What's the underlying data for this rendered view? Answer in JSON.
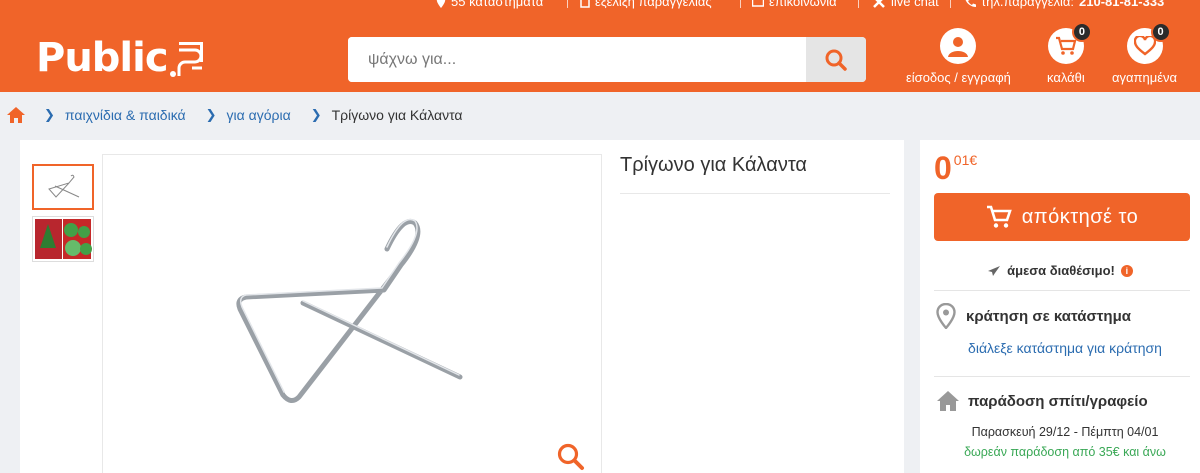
{
  "colors": {
    "brand": "#f06429",
    "link": "#2b6cb0",
    "success": "#3aa856"
  },
  "topbar": {
    "stores": "55 καταστήματα",
    "tracking": "εξέλιξη παραγγελίας",
    "contact": "επικοινωνία",
    "chat": "live chat",
    "phone_label": "τηλ.παραγγελία:",
    "phone_number": "210-81-81-333"
  },
  "header": {
    "logo_text": "Public",
    "logo_suffix": "gr",
    "search_placeholder": "ψάχνω για...",
    "search_icon": "search-icon",
    "login_label": "είσοδος / εγγραφή",
    "cart_label": "καλάθι",
    "cart_count": "0",
    "favorites_label": "αγαπημένα",
    "favorites_count": "0"
  },
  "breadcrumb": {
    "items": [
      "παιχνίδια & παιδικά",
      "για αγόρια"
    ],
    "current": "Τρίγωνο για Κάλαντα"
  },
  "product": {
    "title": "Τρίγωνο για Κάλαντα",
    "thumbnails": [
      "triangle-thumbnail",
      "package-thumbnail"
    ],
    "price_int": "0",
    "price_dec": "01€",
    "buy_label": "απόκτησέ το",
    "availability": "άμεσα διαθέσιμο!",
    "store_title": "κράτηση σε κατάστημα",
    "store_link": "διάλεξε κατάστημα για κράτηση",
    "home_title": "παράδοση σπίτι/γραφείο",
    "delivery_dates": "Παρασκευή 29/12 - Πέμπτη 04/01",
    "free_shipping": "δωρεάν παράδοση από 35€ και άνω"
  }
}
